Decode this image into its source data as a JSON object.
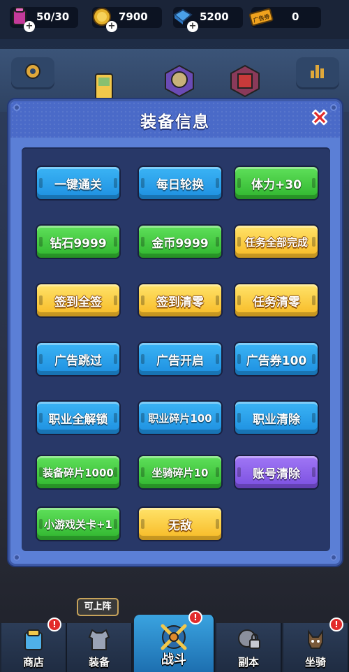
{
  "resources": {
    "stamina": {
      "value": "50/30",
      "icon": "stamina-potion-icon"
    },
    "coin": {
      "value": "7900",
      "icon": "gold-coin-icon"
    },
    "gem": {
      "value": "5200",
      "icon": "blue-gem-icon"
    },
    "ticket": {
      "value": "0",
      "icon": "ad-ticket-icon",
      "label": "广告券"
    }
  },
  "panel": {
    "title": "装备信息",
    "buttons": [
      {
        "label": "一键通关",
        "color": "blue"
      },
      {
        "label": "每日轮换",
        "color": "blue"
      },
      {
        "label": "体力+30",
        "color": "green"
      },
      {
        "label": "钻石9999",
        "color": "green"
      },
      {
        "label": "金币9999",
        "color": "green"
      },
      {
        "label": "任务全部完成",
        "color": "yellow"
      },
      {
        "label": "签到全签",
        "color": "yellow"
      },
      {
        "label": "签到清零",
        "color": "yellow"
      },
      {
        "label": "任务清零",
        "color": "yellow"
      },
      {
        "label": "广告跳过",
        "color": "blue"
      },
      {
        "label": "广告开启",
        "color": "blue"
      },
      {
        "label": "广告券100",
        "color": "blue"
      },
      {
        "label": "职业全解锁",
        "color": "blue"
      },
      {
        "label": "职业碎片100",
        "color": "blue"
      },
      {
        "label": "职业清除",
        "color": "blue"
      },
      {
        "label": "装备碎片1000",
        "color": "green"
      },
      {
        "label": "坐骑碎片10",
        "color": "green"
      },
      {
        "label": "账号清除",
        "color": "purple"
      },
      {
        "label": "小游戏关卡+1",
        "color": "green"
      },
      {
        "label": "无敌",
        "color": "yellow"
      }
    ]
  },
  "tooltip": "可上阵",
  "nav": {
    "tabs": [
      {
        "label": "商店",
        "icon": "shop-bag-icon"
      },
      {
        "label": "装备",
        "icon": "armor-vest-icon"
      },
      {
        "label": "战斗",
        "icon": "crossed-swords-icon"
      },
      {
        "label": "副本",
        "icon": "locked-dungeon-icon"
      },
      {
        "label": "坐骑",
        "icon": "dog-mount-icon"
      }
    ]
  },
  "colors": {
    "accent": "#5b7fd6",
    "blue": "#1d8fe0",
    "green": "#2fb52e",
    "yellow": "#f7b924",
    "purple": "#7a4fe0",
    "close": "#e22b2b"
  }
}
